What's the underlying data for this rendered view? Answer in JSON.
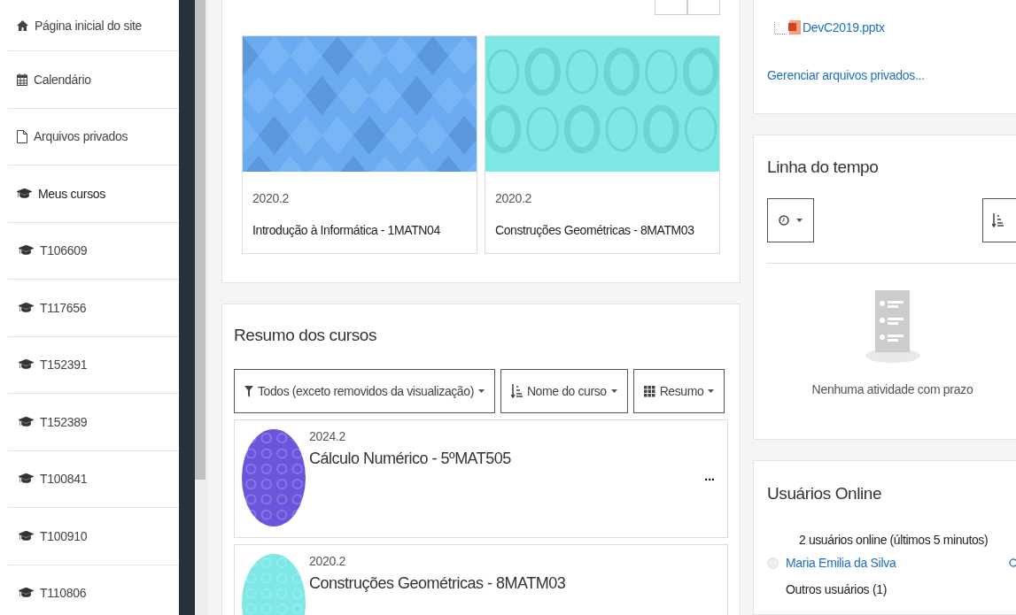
{
  "sidebar": {
    "items": [
      {
        "kind": "home",
        "label": "Página inicial do site"
      },
      {
        "kind": "calendar",
        "label": "Calendário"
      },
      {
        "kind": "file",
        "label": "Arquivos privados"
      },
      {
        "kind": "heading",
        "label": "Meus cursos"
      },
      {
        "kind": "course",
        "label": "T106609"
      },
      {
        "kind": "course",
        "label": "T117656"
      },
      {
        "kind": "course",
        "label": "T152391"
      },
      {
        "kind": "course",
        "label": "T152389"
      },
      {
        "kind": "course",
        "label": "T100841"
      },
      {
        "kind": "course",
        "label": "T100910"
      },
      {
        "kind": "course",
        "label": "T110806"
      }
    ]
  },
  "recent_courses": [
    {
      "kind": "diamonds",
      "term": "2020.2",
      "name": "Introdução à Informática - 1MATN04"
    },
    {
      "kind": "circles",
      "term": "2020.2",
      "name": "Construções Geométricas - 8MATM03"
    }
  ],
  "course_overview": {
    "title": "Resumo dos cursos",
    "filters": [
      {
        "kind": "filter",
        "label": "Todos (exceto removidos da visualização)"
      },
      {
        "kind": "sort",
        "label": "Nome do curso"
      },
      {
        "kind": "grid",
        "label": "Resumo"
      }
    ],
    "courses": [
      {
        "kind": "purple",
        "term": "2024.2",
        "name": "Cálculo Numérico - 5ºMAT505",
        "menu": "..."
      },
      {
        "kind": "cyan",
        "term": "2020.2",
        "name": "Construções Geométricas - 8MATM03"
      }
    ]
  },
  "private_files": {
    "file": "DevC2019.pptx",
    "manage_link": "Gerenciar arquivos privados..."
  },
  "timeline": {
    "title": "Linha do tempo",
    "empty_text": "Nenhuma atividade com prazo"
  },
  "online_users": {
    "title": "Usuários Online",
    "summary": "2 usuários online (últimos 5 minutos)",
    "users": [
      {
        "name": "Maria Emilia da Silva"
      }
    ],
    "others": "Outros usuários (1)"
  }
}
